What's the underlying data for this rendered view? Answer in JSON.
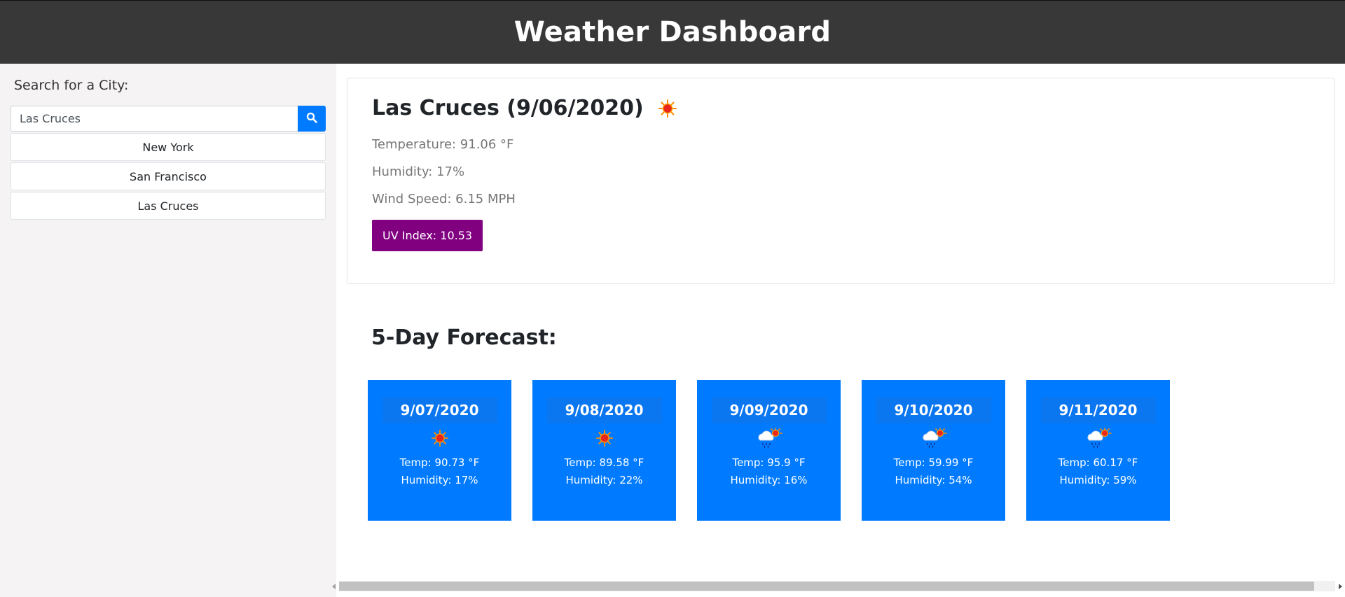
{
  "header": {
    "title": "Weather Dashboard"
  },
  "sidebar": {
    "label": "Search for a City:",
    "search": {
      "value": "Las Cruces",
      "placeholder": ""
    },
    "search_icon": "search-icon",
    "history": [
      "New York",
      "San Francisco",
      "Las Cruces"
    ]
  },
  "current": {
    "title": "Las Cruces (9/06/2020)",
    "icon": "sun-icon",
    "temperature": "Temperature: 91.06 °F",
    "humidity": "Humidity: 17%",
    "wind": "Wind Speed: 6.15 MPH",
    "uv": "UV Index: 10.53",
    "uv_color": "#800080"
  },
  "forecast": {
    "title": "5-Day Forecast:",
    "days": [
      {
        "date": "9/07/2020",
        "icon": "sun-icon",
        "temp": "Temp: 90.73 °F",
        "humidity": "Humidity: 17%"
      },
      {
        "date": "9/08/2020",
        "icon": "sun-icon",
        "temp": "Temp: 89.58 °F",
        "humidity": "Humidity: 22%"
      },
      {
        "date": "9/09/2020",
        "icon": "rain-cloud-sun-icon",
        "temp": "Temp: 95.9 °F",
        "humidity": "Humidity: 16%"
      },
      {
        "date": "9/10/2020",
        "icon": "rain-cloud-sun-icon",
        "temp": "Temp: 59.99 °F",
        "humidity": "Humidity: 54%"
      },
      {
        "date": "9/11/2020",
        "icon": "rain-cloud-sun-icon",
        "temp": "Temp: 60.17 °F",
        "humidity": "Humidity: 59%"
      }
    ]
  },
  "colors": {
    "header_bg": "#383838",
    "accent": "#007bff",
    "sidebar_bg": "#f5f3f3"
  }
}
